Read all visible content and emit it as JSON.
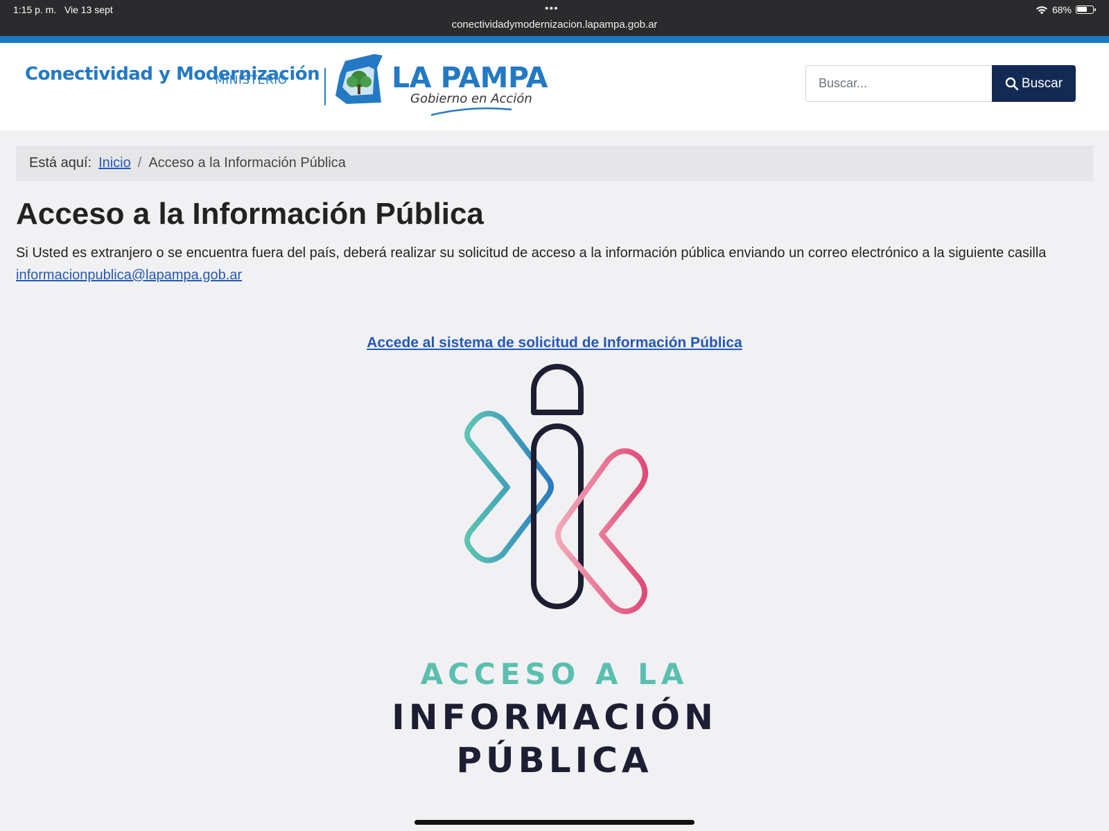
{
  "status_bar": {
    "time": "1:15 p. m.",
    "date": "Vie 13 sept",
    "url": "conectividadymodernizacion.lapampa.gob.ar",
    "battery": "68%",
    "battery_level": 0.68
  },
  "header": {
    "ministry_name": "Conectividad y Modernización",
    "ministry_label": "MINISTERIO",
    "gov_name": "LA PAMPA",
    "gov_slogan": "Gobierno en Acción",
    "search_placeholder": "Buscar...",
    "search_button": "Buscar"
  },
  "breadcrumb": {
    "prefix": "Está aquí:",
    "home": "Inicio",
    "separator": "/",
    "current": "Acceso a la Información Pública"
  },
  "content": {
    "title": "Acceso a la Información Pública",
    "intro_text": "Si Usted es extranjero o se encuentra fuera del país, deberá realizar su solicitud de acceso a la información pública enviando un correo electrónico a la siguiente casilla",
    "email": "informacionpublica@lapampa.gob.ar",
    "cta_link": "Accede al sistema de solicitud de Información Pública"
  },
  "logo": {
    "line1": "ACCESO A LA",
    "line2": "INFORMACIÓN",
    "line3": "PÚBLICA"
  },
  "colors": {
    "brand_blue": "#2479c4",
    "navy": "#132a55",
    "teal": "#5bbfb0",
    "pink": "#e35880",
    "link": "#2358b8"
  }
}
